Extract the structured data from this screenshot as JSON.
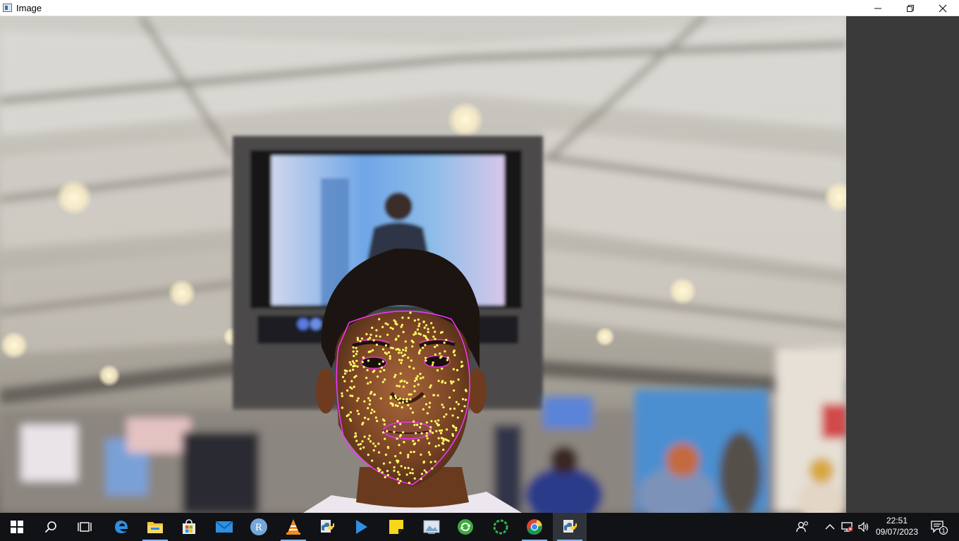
{
  "window": {
    "title": "Image",
    "buttons": {
      "minimize": "minimize-icon",
      "maximize": "restore-icon",
      "close": "close-icon"
    }
  },
  "image": {
    "description_icon": "face-landmark-photo",
    "overlay_colors": {
      "landmarks": "#ffff66",
      "contour": "#ff33ff"
    }
  },
  "taskbar": {
    "start": "windows-start-icon",
    "search": "search-icon",
    "task_view": "task-view-icon",
    "apps": [
      {
        "name": "edge-icon"
      },
      {
        "name": "file-explorer-icon"
      },
      {
        "name": "store-icon"
      },
      {
        "name": "mail-icon"
      },
      {
        "name": "r-icon",
        "label": "R"
      },
      {
        "name": "vlc-icon"
      },
      {
        "name": "python-icon"
      },
      {
        "name": "media-player-icon"
      },
      {
        "name": "sticky-notes-icon"
      },
      {
        "name": "photos-icon"
      },
      {
        "name": "sync-icon"
      },
      {
        "name": "loading-ring-icon"
      },
      {
        "name": "chrome-icon"
      },
      {
        "name": "python-active-icon"
      }
    ],
    "tray": {
      "people": "people-icon",
      "chevron": "chevron-up-icon",
      "network": "network-icon",
      "volume": "volume-icon",
      "time": "22:51",
      "date": "09/07/2023",
      "notifications": "1"
    }
  }
}
